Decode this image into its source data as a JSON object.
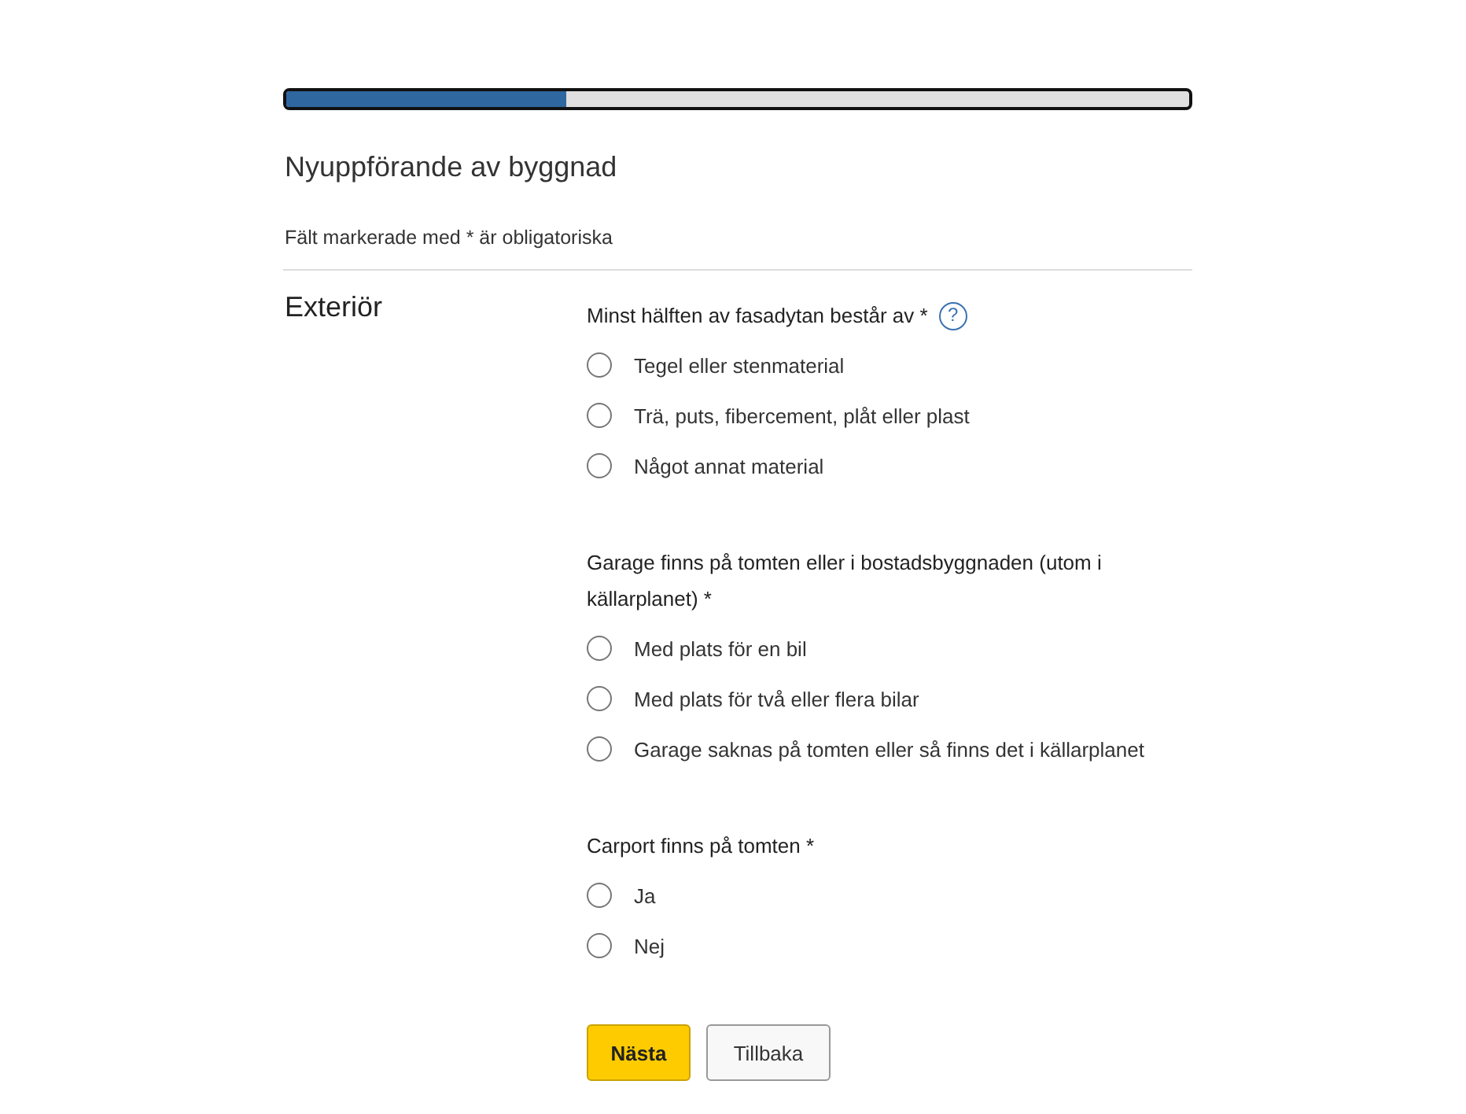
{
  "progress": {
    "level": 0.31
  },
  "title": "Nyuppförande av byggnad",
  "note": "Fält markerade med * är obligatoriska",
  "section": {
    "heading": "Exteriör",
    "questions": [
      {
        "label": "Minst hälften av fasadytan består av *",
        "help": "?",
        "options": [
          {
            "label": "Tegel eller stenmaterial",
            "selected": false
          },
          {
            "label": "Trä, puts, fibercement, plåt eller plast",
            "selected": false
          },
          {
            "label": "Något annat material",
            "selected": false
          }
        ]
      },
      {
        "label": "Garage finns på tomten eller i bostadsbyggnaden (utom i källarplanet) *",
        "options": [
          {
            "label": "Med plats för en bil",
            "selected": false
          },
          {
            "label": "Med plats för två eller flera bilar",
            "selected": false
          },
          {
            "label": "Garage saknas på tomten eller så finns det i källarplanet",
            "selected": false
          }
        ]
      },
      {
        "label": "Carport finns på tomten *",
        "options": [
          {
            "label": "Ja",
            "selected": false
          },
          {
            "label": "Nej",
            "selected": false
          }
        ]
      }
    ]
  },
  "buttons": [
    {
      "label": "Nästa",
      "kind": "primary"
    },
    {
      "label": "Tillbaka",
      "kind": "secondary"
    }
  ]
}
